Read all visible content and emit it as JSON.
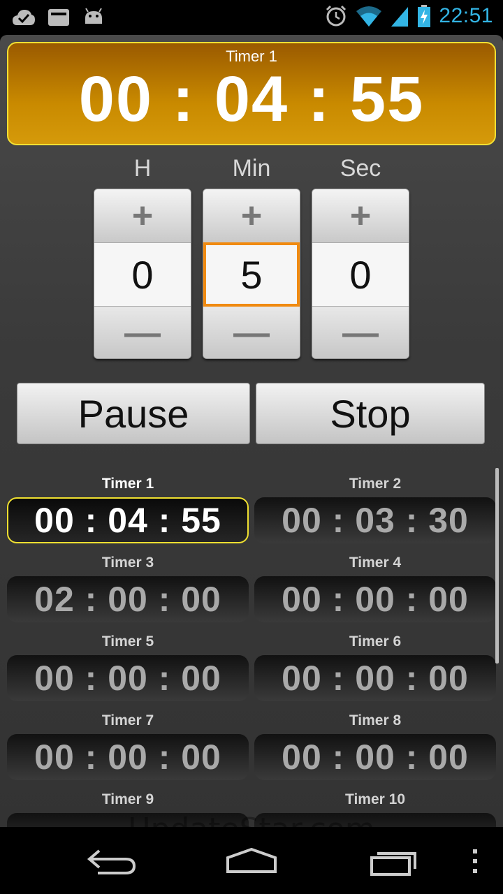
{
  "status_bar": {
    "left_icons": [
      "cloud-check-icon",
      "folder-icon",
      "android-icon"
    ],
    "right_icons": [
      "alarm-icon",
      "wifi-icon",
      "signal-icon",
      "battery-charging-icon"
    ],
    "time": "22:51"
  },
  "main_timer": {
    "label": "Timer 1",
    "time": "00 : 04 : 55"
  },
  "spinners": [
    {
      "label": "H",
      "value": "0"
    },
    {
      "label": "Min",
      "value": "5"
    },
    {
      "label": "Sec",
      "value": "0"
    }
  ],
  "spinner_plus": "+",
  "spinner_minus": "—",
  "actions": {
    "pause_label": "Pause",
    "stop_label": "Stop"
  },
  "timers": [
    {
      "label": "Timer 1",
      "time": "00 : 04 : 55"
    },
    {
      "label": "Timer 2",
      "time": "00 : 03 : 30"
    },
    {
      "label": "Timer 3",
      "time": "02 : 00 : 00"
    },
    {
      "label": "Timer 4",
      "time": "00 : 00 : 00"
    },
    {
      "label": "Timer 5",
      "time": "00 : 00 : 00"
    },
    {
      "label": "Timer 6",
      "time": "00 : 00 : 00"
    },
    {
      "label": "Timer 7",
      "time": "00 : 00 : 00"
    },
    {
      "label": "Timer 8",
      "time": "00 : 00 : 00"
    },
    {
      "label": "Timer 9",
      "time": ""
    },
    {
      "label": "Timer 10",
      "time": ""
    }
  ],
  "watermark": "UpdateStar.com",
  "nav": [
    "back-icon",
    "home-icon",
    "recent-apps-icon",
    "overflow-menu-icon"
  ],
  "colors": {
    "accent_clock": "#33b5e5",
    "active_border": "#f2e033",
    "focus_orange": "#f08a10"
  }
}
